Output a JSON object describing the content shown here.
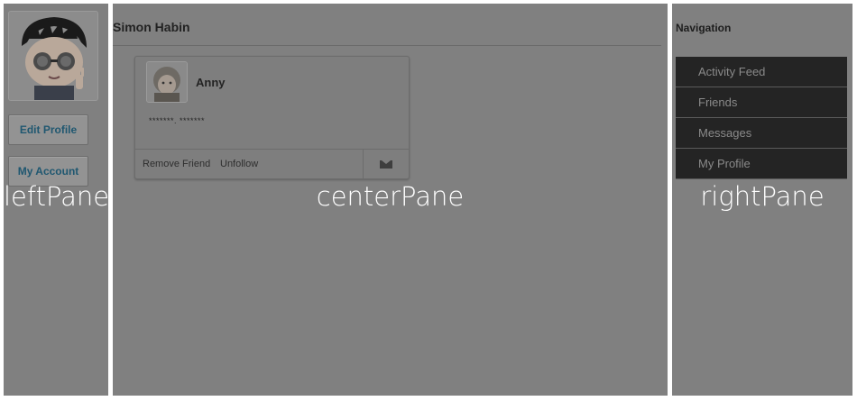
{
  "panes": {
    "left": {
      "caption": "leftPane"
    },
    "center": {
      "caption": "centerPane"
    },
    "right": {
      "caption": "rightPane"
    }
  },
  "left": {
    "edit_profile_label": "Edit Profile",
    "my_account_label": "My Account"
  },
  "center": {
    "title": "Simon Habin",
    "card": {
      "name": "Anny",
      "meta": "*******. *******",
      "remove_label": "Remove Friend",
      "unfollow_label": "Unfollow",
      "mail_icon": "mail-icon"
    }
  },
  "right": {
    "nav_title": "Navigation",
    "items": [
      {
        "label": "Activity Feed"
      },
      {
        "label": "Friends"
      },
      {
        "label": "Messages"
      },
      {
        "label": "My Profile"
      }
    ]
  },
  "colors": {
    "overlay": "#808080",
    "nav_bg": "#242424",
    "button_text": "#1f5770"
  }
}
